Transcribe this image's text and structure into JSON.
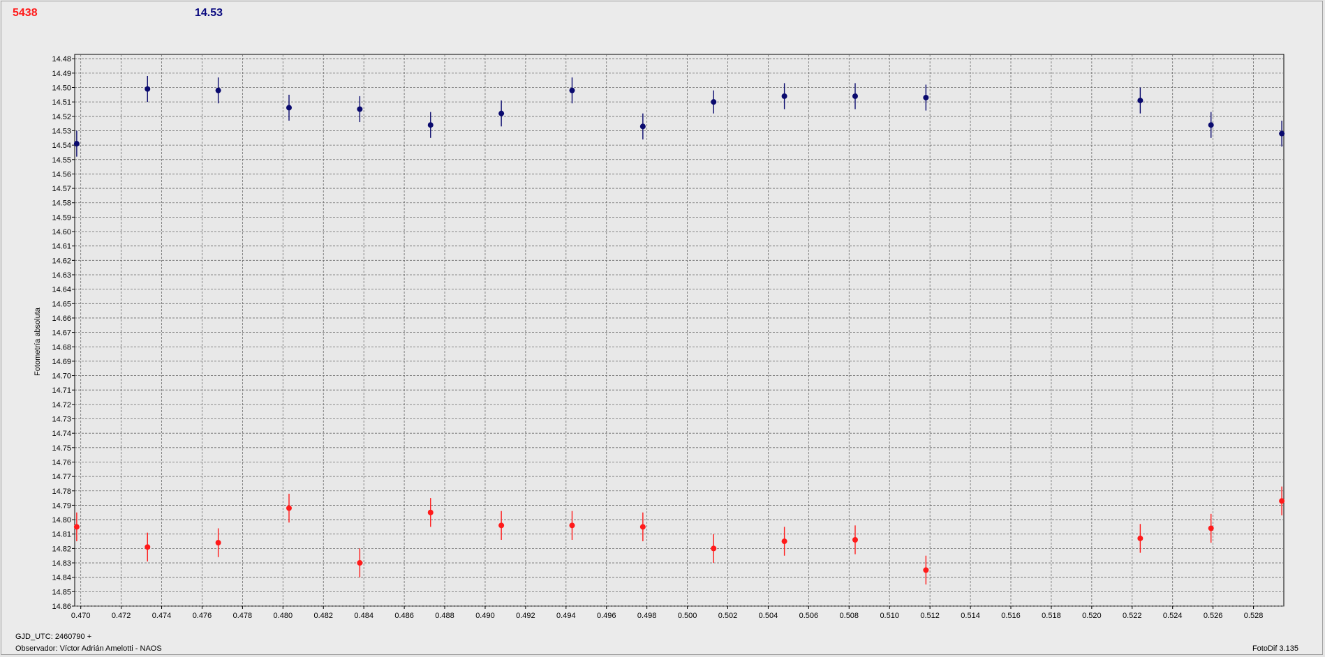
{
  "header": {
    "left_value": "5438",
    "left_color": "#ff1a1a",
    "right_value": "14.53",
    "right_color": "#0a0a80"
  },
  "footer": {
    "gjd": "GJD_UTC: 2460790 +",
    "observer": "Observador: Víctor Adrián Amelotti - NAOS",
    "version": "FotoDif 3.135"
  },
  "chart_data": {
    "type": "scatter",
    "ylabel": "Fotometría absoluta",
    "xlabel": "",
    "xlim": [
      0.4697,
      0.5295
    ],
    "ylim": [
      14.86,
      14.477
    ],
    "y_inverted": true,
    "grid": true,
    "x_ticks": [
      "0.470",
      "0.472",
      "0.474",
      "0.476",
      "0.478",
      "0.480",
      "0.482",
      "0.484",
      "0.486",
      "0.488",
      "0.490",
      "0.492",
      "0.494",
      "0.496",
      "0.498",
      "0.500",
      "0.502",
      "0.504",
      "0.506",
      "0.508",
      "0.510",
      "0.512",
      "0.514",
      "0.516",
      "0.518",
      "0.520",
      "0.522",
      "0.524",
      "0.526",
      "0.528"
    ],
    "y_ticks": [
      "14.48",
      "14.49",
      "14.50",
      "14.51",
      "14.52",
      "14.53",
      "14.54",
      "14.55",
      "14.56",
      "14.57",
      "14.58",
      "14.59",
      "14.60",
      "14.61",
      "14.62",
      "14.63",
      "14.64",
      "14.65",
      "14.66",
      "14.67",
      "14.68",
      "14.69",
      "14.70",
      "14.71",
      "14.72",
      "14.73",
      "14.74",
      "14.75",
      "14.76",
      "14.77",
      "14.78",
      "14.79",
      "14.80",
      "14.81",
      "14.82",
      "14.83",
      "14.84",
      "14.85",
      "14.86"
    ],
    "series": [
      {
        "color": "#0a0a6e",
        "x": [
          0.4698,
          0.4733,
          0.4768,
          0.4803,
          0.4838,
          0.4873,
          0.4908,
          0.4943,
          0.4978,
          0.5013,
          0.5048,
          0.5083,
          0.5118,
          0.5224,
          0.5259,
          0.5294
        ],
        "y": [
          14.539,
          14.501,
          14.502,
          14.514,
          14.515,
          14.526,
          14.518,
          14.502,
          14.527,
          14.51,
          14.506,
          14.506,
          14.507,
          14.509,
          14.526,
          14.532
        ],
        "err": [
          0.009,
          0.009,
          0.009,
          0.009,
          0.009,
          0.009,
          0.009,
          0.009,
          0.009,
          0.008,
          0.009,
          0.009,
          0.009,
          0.009,
          0.009,
          0.009
        ]
      },
      {
        "color": "#ff1a1a",
        "x": [
          0.4698,
          0.4733,
          0.4768,
          0.4803,
          0.4838,
          0.4873,
          0.4908,
          0.4943,
          0.4978,
          0.5013,
          0.5048,
          0.5083,
          0.5118,
          0.5224,
          0.5259,
          0.5294
        ],
        "y": [
          14.805,
          14.819,
          14.816,
          14.792,
          14.83,
          14.795,
          14.804,
          14.804,
          14.805,
          14.82,
          14.815,
          14.814,
          14.835,
          14.813,
          14.806,
          14.787
        ],
        "err": [
          0.01,
          0.01,
          0.01,
          0.01,
          0.01,
          0.01,
          0.01,
          0.01,
          0.01,
          0.01,
          0.01,
          0.01,
          0.01,
          0.01,
          0.01,
          0.01
        ]
      }
    ]
  }
}
